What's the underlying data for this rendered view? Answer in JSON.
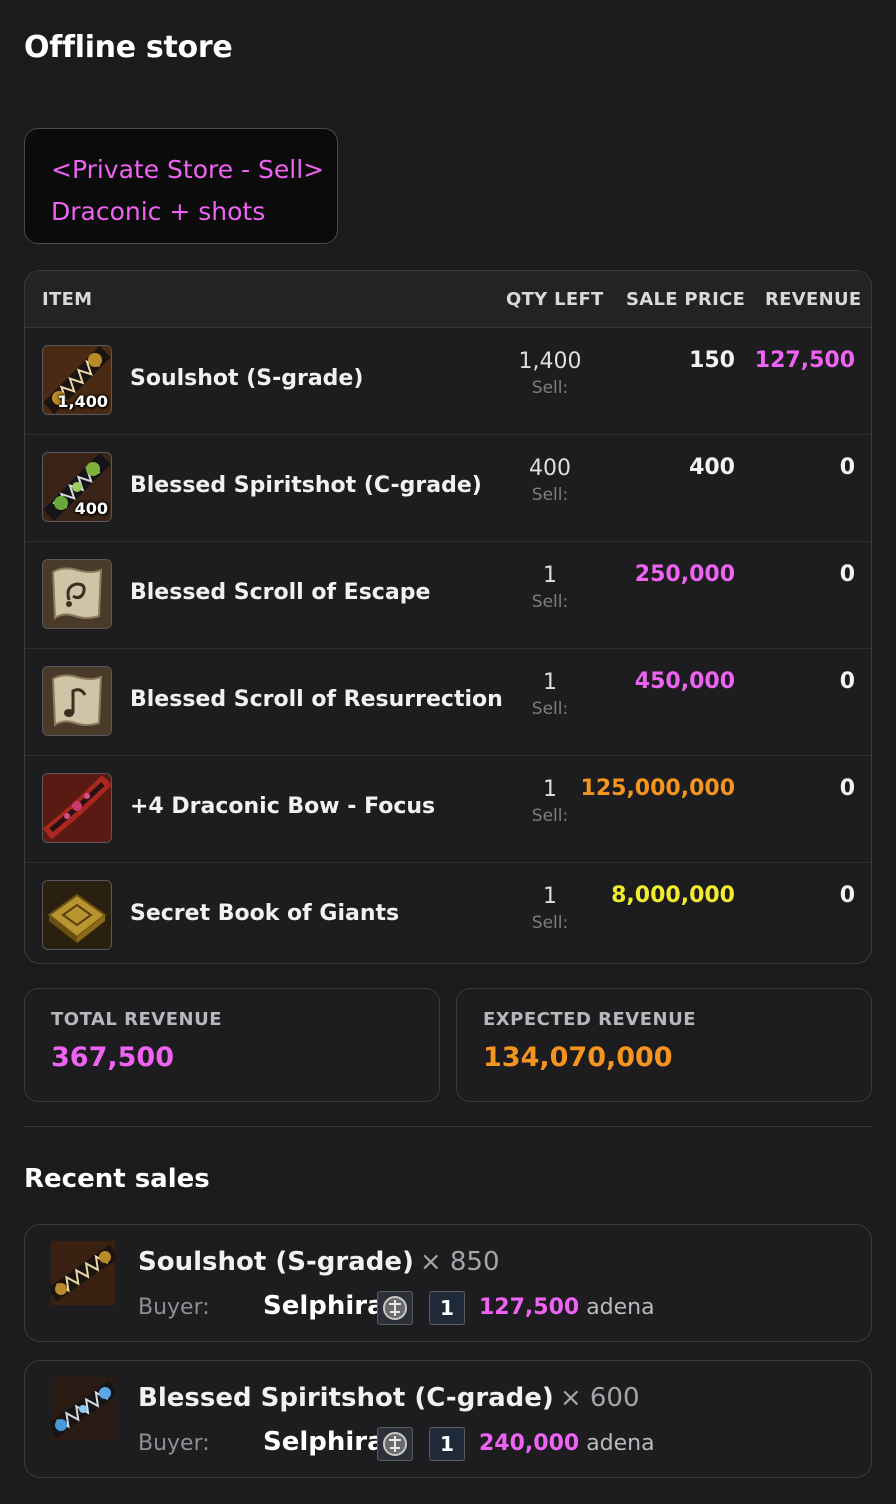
{
  "page": {
    "title": "Offline store"
  },
  "store_message": {
    "line1": "<Private Store - Sell>",
    "line2": "Draconic + shots"
  },
  "table": {
    "headers": {
      "item": "ITEM",
      "qty_left": "QTY LEFT",
      "sale_price": "SALE PRICE",
      "revenue": "REVENUE"
    },
    "rows": [
      {
        "name": "Soulshot (S-grade)",
        "icon": "soulshot-icon",
        "stack": "1,400",
        "qty": "1,400",
        "sell_label": "Sell:",
        "price": "150",
        "price_color": "#f2f2f2",
        "revenue": "127,500",
        "revenue_color": "#ef63f2"
      },
      {
        "name": "Blessed Spiritshot (C-grade)",
        "icon": "spiritshot-icon",
        "stack": "400",
        "qty": "400",
        "sell_label": "Sell:",
        "price": "400",
        "price_color": "#f2f2f2",
        "revenue": "0",
        "revenue_color": "#f2f2f2"
      },
      {
        "name": "Blessed Scroll of Escape",
        "icon": "scroll-icon",
        "stack": "",
        "qty": "1",
        "sell_label": "Sell:",
        "price": "250,000",
        "price_color": "#ef63f2",
        "revenue": "0",
        "revenue_color": "#f2f2f2"
      },
      {
        "name": "Blessed Scroll of Resurrection",
        "icon": "scroll-icon",
        "stack": "",
        "qty": "1",
        "sell_label": "Sell:",
        "price": "450,000",
        "price_color": "#ef63f2",
        "revenue": "0",
        "revenue_color": "#f2f2f2"
      },
      {
        "name": "+4 Draconic Bow - Focus",
        "icon": "bow-icon",
        "stack": "",
        "qty": "1",
        "sell_label": "Sell:",
        "price": "125,000,000",
        "price_color": "#f5941e",
        "revenue": "0",
        "revenue_color": "#f2f2f2"
      },
      {
        "name": "Secret Book of Giants",
        "icon": "book-icon",
        "stack": "",
        "qty": "1",
        "sell_label": "Sell:",
        "price": "8,000,000",
        "price_color": "#f2ee2e",
        "revenue": "0",
        "revenue_color": "#f2f2f2"
      }
    ]
  },
  "totals": {
    "total_label": "TOTAL REVENUE",
    "total_value": "367,500",
    "expected_label": "EXPECTED REVENUE",
    "expected_value": "134,070,000"
  },
  "recent_sales": {
    "title": "Recent sales",
    "items": [
      {
        "name": "Soulshot (S-grade)",
        "qty": "× 850",
        "buyer_label": "Buyer:",
        "buyer": "Selphira",
        "rank": "1",
        "amount": "127,500",
        "unit": "adena",
        "icon": "soulshot-icon"
      },
      {
        "name": "Blessed Spiritshot (C-grade)",
        "qty": "× 600",
        "buyer_label": "Buyer:",
        "buyer": "Selphira",
        "rank": "1",
        "amount": "240,000",
        "unit": "adena",
        "icon": "spiritshot-icon"
      }
    ]
  },
  "colors": {
    "pink": "#ef63f2",
    "orange": "#f5941e",
    "yellow": "#f2ee2e"
  }
}
